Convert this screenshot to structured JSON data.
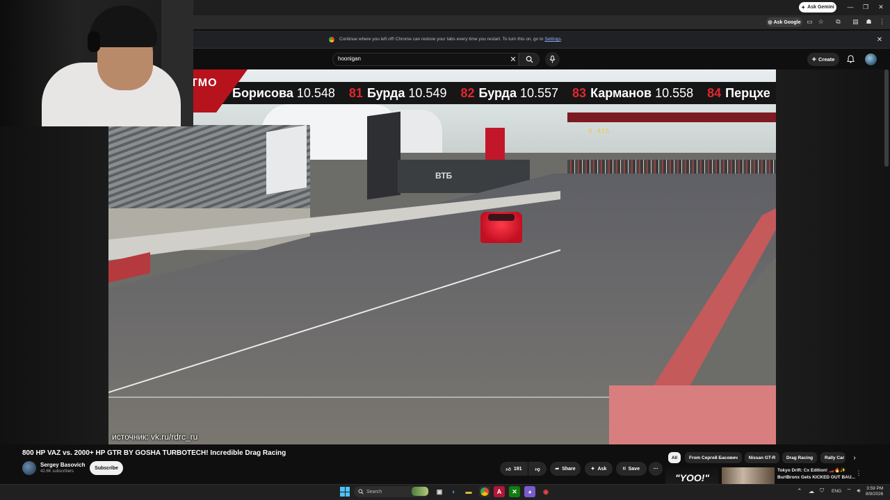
{
  "browser": {
    "ask_gemini_label": "Ask Gemini",
    "ask_google_label": "Ask Google",
    "window_controls": [
      "—",
      "❐",
      "✕"
    ],
    "restore_bar": {
      "message": "Continue where you left off! Chrome can restore your tabs every time you restart. To turn this on, go to",
      "link": "Settings",
      "suffix": "."
    }
  },
  "youtube": {
    "search": {
      "value": "hoonigan"
    },
    "create_label": "Create"
  },
  "video": {
    "ticker": {
      "logo": "ТМО",
      "entries": [
        {
          "rank": "",
          "name": "Борисова",
          "time": "10.548"
        },
        {
          "rank": "81",
          "name": "Бурда",
          "time": "10.549"
        },
        {
          "rank": "82",
          "name": "Бурда",
          "time": "10.557"
        },
        {
          "rank": "83",
          "name": "Карманов",
          "time": "10.558"
        },
        {
          "rank": "84",
          "name": "Перцхе",
          "time": ""
        }
      ]
    },
    "billboard_text": "ВТБ",
    "gantry_display": "0.416",
    "source_caption": "источник: vk.ru/rdrc_ru",
    "title": "800 HP VAZ vs. 2000+ HP GTR BY GOSHA TURBOTECH! Incredible Drag Racing",
    "channel": {
      "name": "Sergey Basovich",
      "subscribers": "42.6K subscribers",
      "subscribe_label": "Subscribe"
    },
    "actions": {
      "likes": "191",
      "share": "Share",
      "ask": "Ask",
      "save": "Save"
    }
  },
  "sidebar": {
    "chips": [
      "All",
      "From Сергей Басович",
      "Nissan GT-R",
      "Drag Racing",
      "Rally Car"
    ],
    "recommendation": {
      "thumb_text": "\"YOO!\"",
      "title": "Tokyo Drift: Cx Edition! 🏎️🔥✨ BurtBronx Gets KICKED OUT BAU..."
    }
  },
  "taskbar": {
    "search_placeholder": "Search",
    "language": "ENG",
    "time": "3:59 PM",
    "date": "8/9/2026"
  },
  "colors": {
    "accent_red": "#e3262e",
    "youtube_bg": "#0f0f0f"
  }
}
